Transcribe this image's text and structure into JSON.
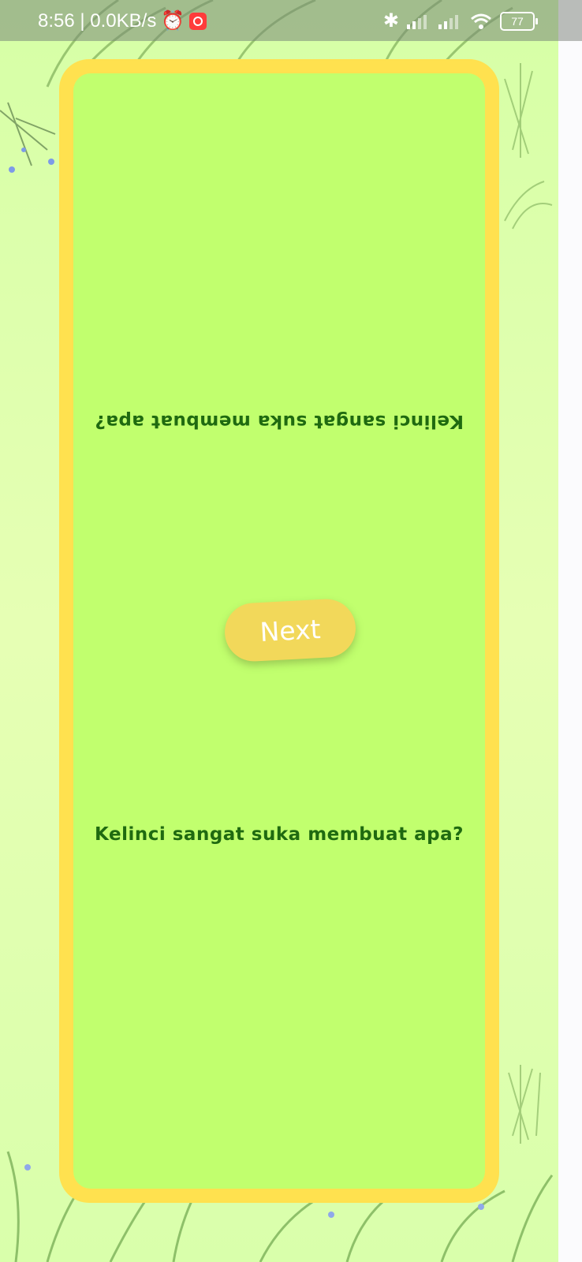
{
  "status_bar": {
    "time_speed": "8:56 | 0.0KB/s",
    "battery": "77",
    "icons": [
      "alarm-icon",
      "record-icon",
      "bluetooth-icon",
      "signal-icon",
      "signal-icon",
      "wifi-icon",
      "battery-icon"
    ]
  },
  "card": {
    "question_flipped": "Kelinci sangat suka membuat apa?",
    "question": "Kelinci sangat suka membuat apa?",
    "next_label": "Next"
  },
  "colors": {
    "background": "#d6ffa6",
    "card_border": "#ffe14f",
    "card_fill": "#c1ff6e",
    "question_text": "#1f6a10",
    "button": "#f2d85a",
    "button_text": "#ffffff"
  }
}
